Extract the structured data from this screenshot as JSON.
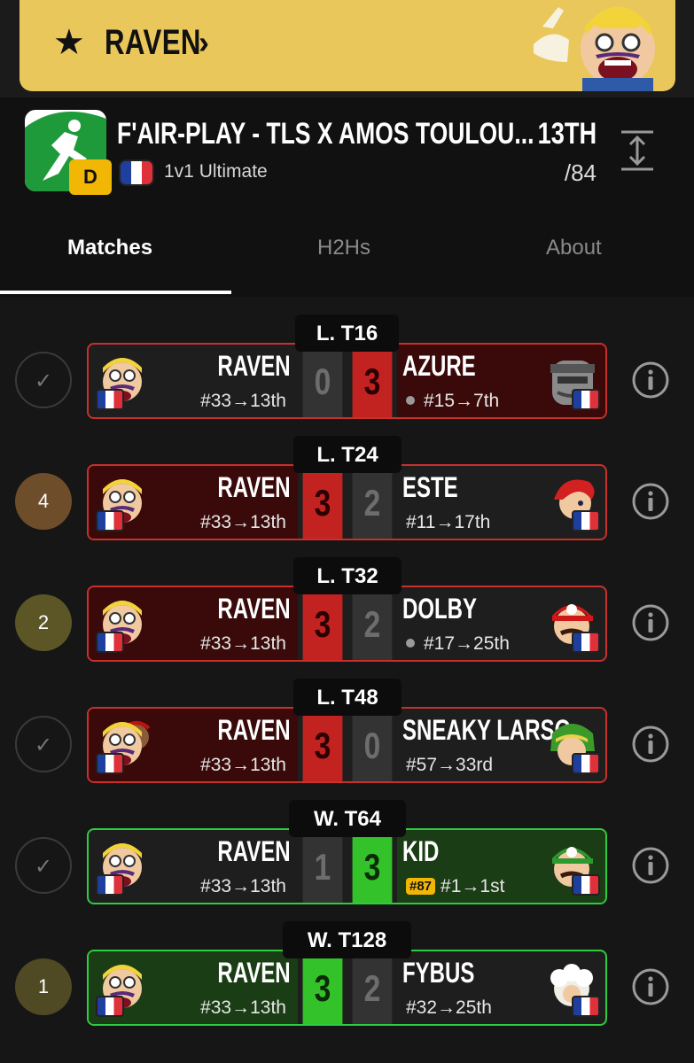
{
  "banner": {
    "player": "RAVEN",
    "chevron": "›"
  },
  "tournament": {
    "title": "F'AIR-PLAY - TLS X AMOS TOULOU...",
    "tier": "D",
    "game": "1v1 Ultimate",
    "placement": "13TH",
    "entrants": "/84"
  },
  "tabs": [
    {
      "label": "Matches",
      "active": true
    },
    {
      "label": "H2Hs",
      "active": false
    },
    {
      "label": "About",
      "active": false
    }
  ],
  "matches": [
    {
      "round": "L. T16",
      "status": "✓",
      "status_type": "check",
      "p1": {
        "name": "RAVEN",
        "seed": "#33→13th",
        "score": "0",
        "result": "loss"
      },
      "p2": {
        "name": "AZURE",
        "seed": "#15→7th",
        "score": "3",
        "result": "win",
        "dot": true,
        "char": "snake"
      }
    },
    {
      "round": "L. T24",
      "status": "4",
      "status_type": "num",
      "status_color": "#6e4d2a",
      "p1": {
        "name": "RAVEN",
        "seed": "#33→13th",
        "score": "3",
        "result": "win"
      },
      "p2": {
        "name": "ESTE",
        "seed": "#11→17th",
        "score": "2",
        "result": "loss",
        "char": "roy"
      }
    },
    {
      "round": "L. T32",
      "status": "2",
      "status_type": "num",
      "status_color": "#5c5627",
      "p1": {
        "name": "RAVEN",
        "seed": "#33→13th",
        "score": "3",
        "result": "win"
      },
      "p2": {
        "name": "DOLBY",
        "seed": "#17→25th",
        "score": "2",
        "result": "loss",
        "dot": true,
        "char": "mario"
      }
    },
    {
      "round": "L. T48",
      "status": "✓",
      "status_type": "check",
      "p1": {
        "name": "RAVEN",
        "seed": "#33→13th",
        "score": "3",
        "result": "win",
        "secondary": true
      },
      "p2": {
        "name": "SNEAKY LARSO...",
        "seed": "#57→33rd",
        "score": "0",
        "result": "loss",
        "char": "link"
      }
    },
    {
      "round": "W. T64",
      "status": "✓",
      "status_type": "check",
      "p1": {
        "name": "RAVEN",
        "seed": "#33→13th",
        "score": "1",
        "result": "loss"
      },
      "p2": {
        "name": "KID",
        "seed": "#1→1st",
        "score": "3",
        "result": "win",
        "chip": "#87",
        "char": "luigi"
      }
    },
    {
      "round": "W. T128",
      "status": "1",
      "status_type": "num",
      "status_color": "#4f4a24",
      "p1": {
        "name": "RAVEN",
        "seed": "#33→13th",
        "score": "3",
        "result": "win"
      },
      "p2": {
        "name": "FYBUS",
        "seed": "#32→25th",
        "score": "2",
        "result": "loss",
        "char": "iceclimber"
      }
    }
  ],
  "colors": {
    "loss_half": "#3a0a0a",
    "win_half": "#1b3d15",
    "red_score": "#c22321",
    "green_score": "#33c22a",
    "tier": "#f2b705"
  }
}
